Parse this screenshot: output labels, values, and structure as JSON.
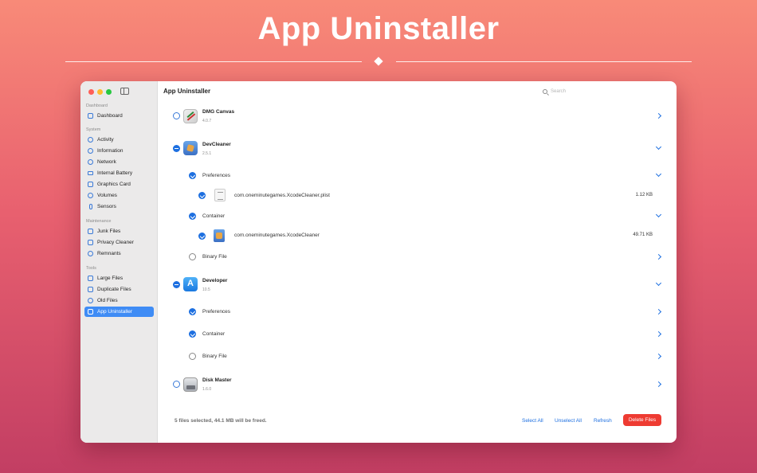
{
  "hero": {
    "title": "App Uninstaller"
  },
  "sidebar": {
    "sections": [
      {
        "label": "Dashboard",
        "items": [
          {
            "label": "Dashboard",
            "icon": "house-icon"
          }
        ]
      },
      {
        "label": "System",
        "items": [
          {
            "label": "Activity",
            "icon": "gauge-icon"
          },
          {
            "label": "Information",
            "icon": "info-icon"
          },
          {
            "label": "Network",
            "icon": "globe-icon"
          },
          {
            "label": "Internal Battery",
            "icon": "battery-icon"
          },
          {
            "label": "Graphics Card",
            "icon": "gpu-icon"
          },
          {
            "label": "Volumes",
            "icon": "drive-icon"
          },
          {
            "label": "Sensors",
            "icon": "thermometer-icon"
          }
        ]
      },
      {
        "label": "Maintenance",
        "items": [
          {
            "label": "Junk Files",
            "icon": "trash-icon"
          },
          {
            "label": "Privacy Cleaner",
            "icon": "shield-icon"
          },
          {
            "label": "Remnants",
            "icon": "magnifier-icon"
          }
        ]
      },
      {
        "label": "Tools",
        "items": [
          {
            "label": "Large Files",
            "icon": "document-icon"
          },
          {
            "label": "Duplicate Files",
            "icon": "documents-icon"
          },
          {
            "label": "Old Files",
            "icon": "clock-icon"
          },
          {
            "label": "App Uninstaller",
            "icon": "app-box-icon",
            "active": true
          }
        ]
      }
    ]
  },
  "main": {
    "title": "App Uninstaller",
    "search_placeholder": "Search",
    "apps": [
      {
        "name": "DMG Canvas",
        "version": "4.0.7",
        "state": "unchecked",
        "expanded": false
      },
      {
        "name": "DevCleaner",
        "version": "2.5.1",
        "state": "mixed",
        "expanded": true,
        "groups": [
          {
            "label": "Preferences",
            "checked": true,
            "expanded": true,
            "files": [
              {
                "name": "com.oneminutegames.XcodeCleaner.plist",
                "size": "1.12 KB",
                "checked": true
              }
            ]
          },
          {
            "label": "Container",
            "checked": true,
            "expanded": true,
            "files": [
              {
                "name": "com.oneminutegames.XcodeCleaner",
                "size": "49.71 KB",
                "checked": true
              }
            ]
          },
          {
            "label": "Binary File",
            "checked": false,
            "expanded": false,
            "files": []
          }
        ]
      },
      {
        "name": "Developer",
        "version": "10.5",
        "state": "mixed",
        "expanded": true,
        "groups": [
          {
            "label": "Preferences",
            "checked": true,
            "expanded": false
          },
          {
            "label": "Container",
            "checked": true,
            "expanded": false
          },
          {
            "label": "Binary File",
            "checked": false,
            "expanded": false
          }
        ]
      },
      {
        "name": "Disk Master",
        "version": "1.6.0",
        "state": "unchecked",
        "expanded": false
      }
    ],
    "footer": {
      "status": "5 files selected, 44.1 MB will be freed.",
      "select_all": "Select All",
      "unselect_all": "Unselect All",
      "refresh": "Refresh",
      "delete": "Delete Files"
    }
  },
  "colors": {
    "accent": "#1d6fe0",
    "danger": "#ee3b32",
    "sidebar_active": "#3f8cf5"
  }
}
